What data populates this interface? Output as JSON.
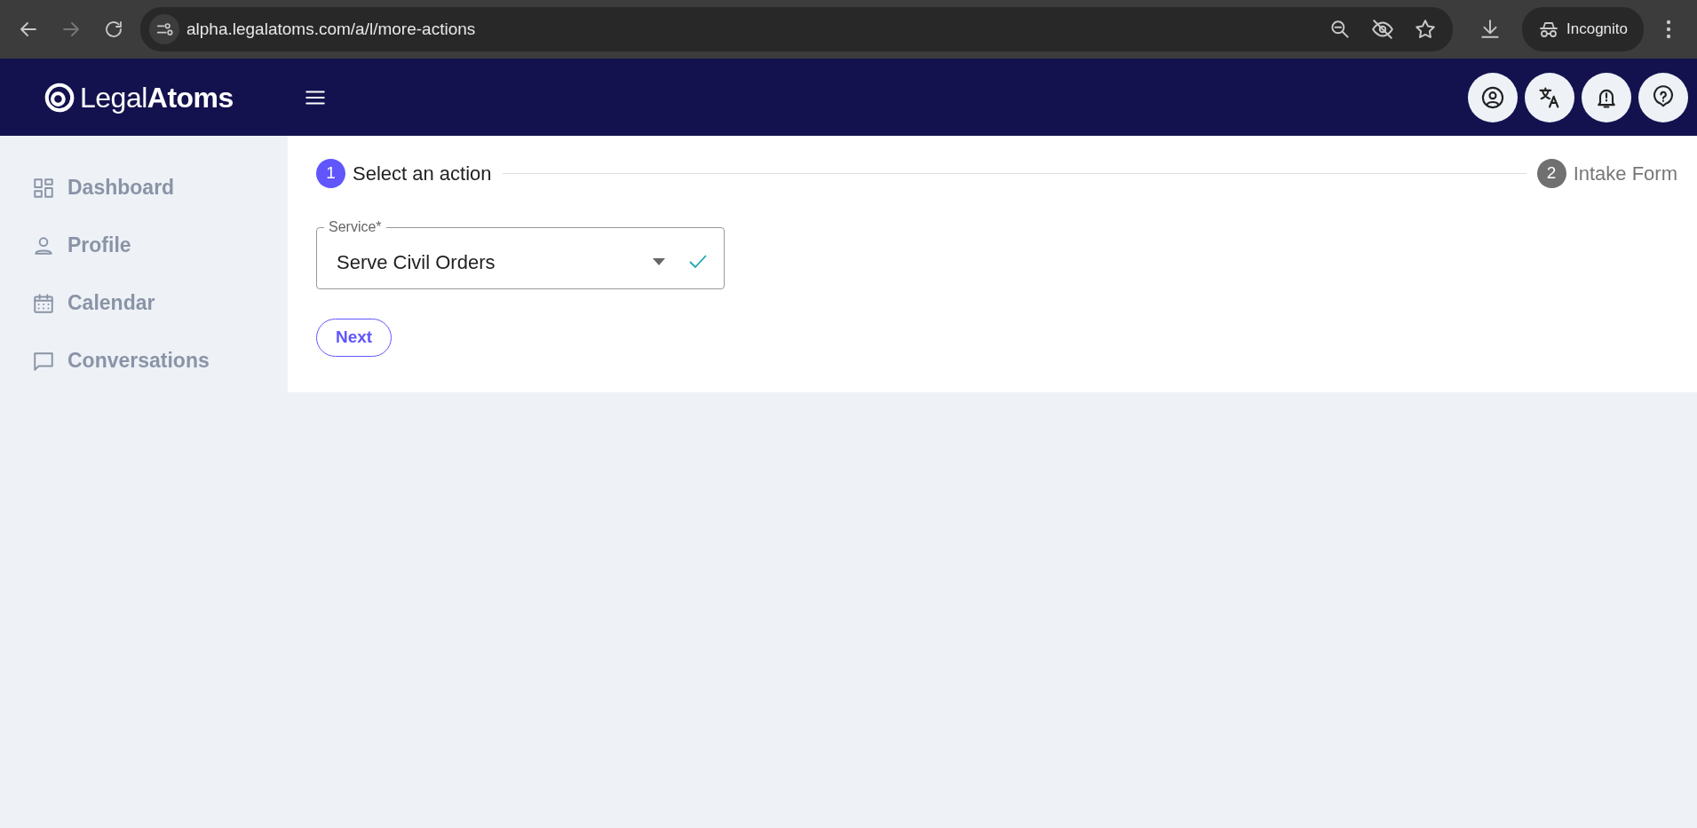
{
  "browser": {
    "url": "alpha.legalatoms.com/a/l/more-actions",
    "profile_label": "Incognito"
  },
  "header": {
    "logo": "Legal**Atoms**"
  },
  "sidebar": {
    "items": [
      {
        "label": "Dashboard",
        "kind": "dashboard"
      },
      {
        "label": "Profile",
        "kind": "profile"
      },
      {
        "label": "Calendar",
        "kind": "calendar"
      },
      {
        "label": "Conversations",
        "kind": "chat"
      }
    ]
  },
  "stepper": [
    {
      "number": "1",
      "label": "Select an action",
      "active": true
    },
    {
      "number": "2",
      "label": "Intake Form",
      "active": false
    }
  ],
  "form": {
    "field": {
      "label": "Service*",
      "value": "Serve Civil Orders",
      "valid": true
    },
    "button": "Next"
  }
}
